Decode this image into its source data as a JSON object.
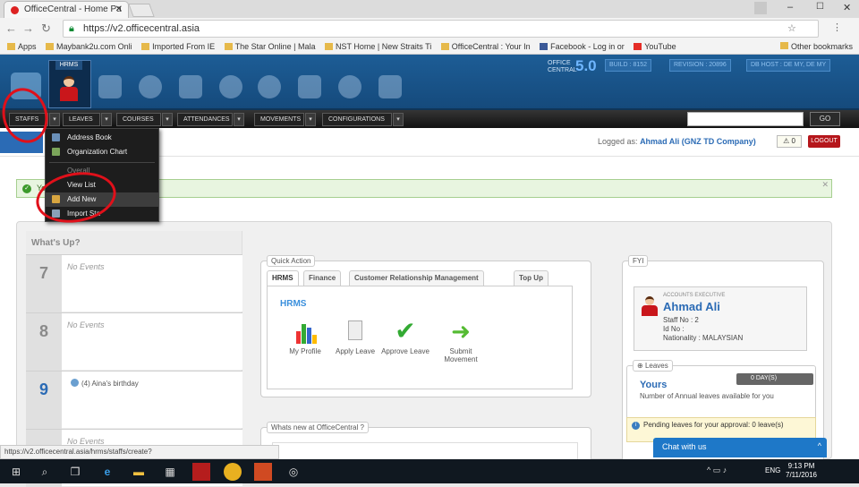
{
  "browser": {
    "tab_title": "OfficeCentral - Home Pa",
    "url": "https://v2.officecentral.asia",
    "bookmarks": [
      "Apps",
      "Maybank2u.com Onli",
      "Imported From IE",
      "The Star Online | Mala",
      "NST Home | New Straits Ti",
      "OfficeCentral : Your In",
      "Facebook - Log in or",
      "YouTube"
    ],
    "other_bookmarks": "Other bookmarks"
  },
  "header": {
    "hrms_label": "HRMS",
    "logo_small": "OFFICE CENTRAL",
    "logo_version": "5.0",
    "build": "BUILD : 8152",
    "revision": "REVISION : 20896",
    "db_host": "DB HOST : DE MY, DE MY"
  },
  "menu": {
    "items": [
      "STAFFS",
      "LEAVES",
      "COURSES",
      "ATTENDANCES",
      "MOVEMENTS",
      "CONFIGURATIONS"
    ],
    "go": "GO"
  },
  "dropdown": {
    "items": [
      "Address Book",
      "Organization Chart",
      "Overall",
      "View List",
      "Add New",
      "Import Sta"
    ]
  },
  "session": {
    "logged_as_label": "Logged as:",
    "user": "Ahmad Ali (GNZ TD Company)",
    "notifications": "0",
    "logout": "LOGOUT"
  },
  "alert": {
    "text": "Yo"
  },
  "whats_up": {
    "title": "What's Up?",
    "days": [
      {
        "num": "7",
        "text": "No Events"
      },
      {
        "num": "8",
        "text": "No Events"
      },
      {
        "num": "9",
        "text": "(4) Aina's birthday"
      },
      {
        "num": "",
        "text": "No Events"
      }
    ]
  },
  "quick_action": {
    "legend": "Quick Action",
    "tabs": [
      "HRMS",
      "Finance",
      "Customer Relationship Management",
      "Top Up"
    ],
    "section": "HRMS",
    "actions": [
      "My Profile",
      "Apply Leave",
      "Approve Leave",
      "Submit Movement"
    ]
  },
  "whats_new": {
    "legend": "Whats new at OfficeCentral ?"
  },
  "fyi": {
    "legend": "FYI",
    "role": "ACCOUNTS EXECUTIVE",
    "name": "Ahmad Ali",
    "staff_no": "Staff No : 2",
    "id_no": "Id No :",
    "nationality": "Nationality : MALAYSIAN",
    "leaves_legend": "Leaves",
    "leaves_badge": "0 DAY(S)",
    "yours": "Yours",
    "yours_desc": "Number of Annual leaves available for you",
    "pending": "Pending leaves for your approval: 0 leave(s)"
  },
  "chat": {
    "label": "Chat with us"
  },
  "status_url": "https://v2.officecentral.asia/hrms/staffs/create?",
  "taskbar": {
    "lang": "ENG",
    "time": "9:13 PM",
    "date": "7/11/2016"
  }
}
